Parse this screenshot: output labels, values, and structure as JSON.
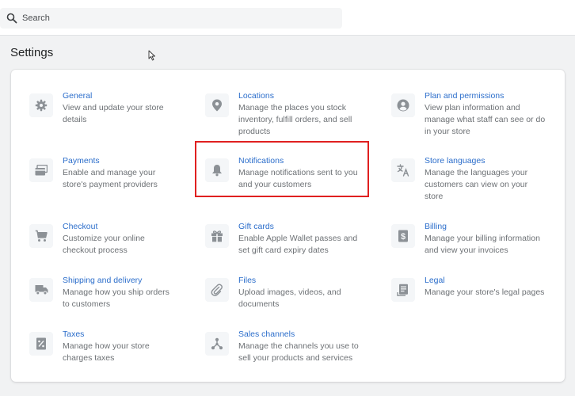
{
  "search": {
    "placeholder": "Search"
  },
  "page_title": "Settings",
  "settings_items": [
    {
      "title": "General",
      "description": "View and update your store details",
      "icon": "gear-icon"
    },
    {
      "title": "Locations",
      "description": "Manage the places you stock inventory, fulfill orders, and sell products",
      "icon": "location-pin-icon"
    },
    {
      "title": "Plan and permissions",
      "description": "View plan information and manage what staff can see or do in your store",
      "icon": "user-icon"
    },
    {
      "title": "Payments",
      "description": "Enable and manage your store's payment providers",
      "icon": "payments-icon"
    },
    {
      "title": "Notifications",
      "description": "Manage notifications sent to you and your customers",
      "icon": "bell-icon"
    },
    {
      "title": "Store languages",
      "description": "Manage the languages your customers can view on your store",
      "icon": "translate-icon"
    },
    {
      "title": "Checkout",
      "description": "Customize your online checkout process",
      "icon": "cart-icon"
    },
    {
      "title": "Gift cards",
      "description": "Enable Apple Wallet passes and set gift card expiry dates",
      "icon": "gift-icon"
    },
    {
      "title": "Billing",
      "description": "Manage your billing information and view your invoices",
      "icon": "dollar-icon"
    },
    {
      "title": "Shipping and delivery",
      "description": "Manage how you ship orders to customers",
      "icon": "truck-icon"
    },
    {
      "title": "Files",
      "description": "Upload images, videos, and documents",
      "icon": "paperclip-icon"
    },
    {
      "title": "Legal",
      "description": "Manage your store's legal pages",
      "icon": "document-icon"
    },
    {
      "title": "Taxes",
      "description": "Manage how your store charges taxes",
      "icon": "tax-icon"
    },
    {
      "title": "Sales channels",
      "description": "Manage the channels you use to sell your products and services",
      "icon": "channels-icon"
    }
  ],
  "colors": {
    "link": "#2c6ecb",
    "muted_text": "#6d7175",
    "highlight": "#e02020",
    "icon": "#8c9196"
  }
}
